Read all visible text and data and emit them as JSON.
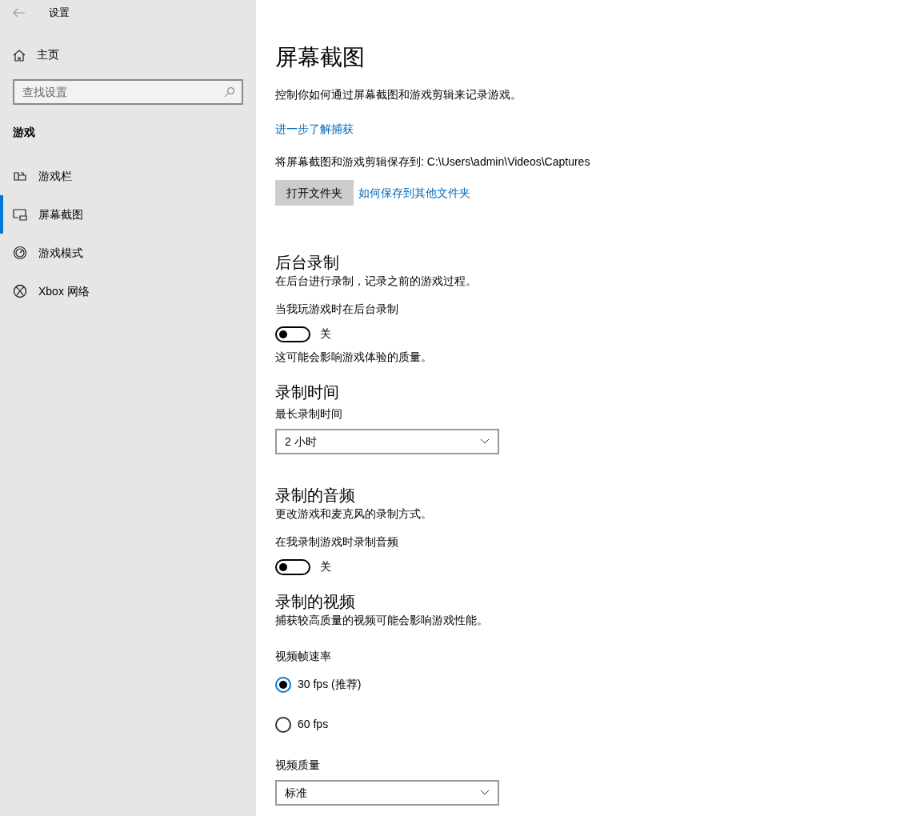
{
  "window": {
    "title": "设置"
  },
  "sidebar": {
    "home": "主页",
    "search": {
      "placeholder": "查找设置"
    },
    "group": "游戏",
    "items": [
      {
        "label": "游戏栏",
        "selected": false
      },
      {
        "label": "屏幕截图",
        "selected": true
      },
      {
        "label": "游戏模式",
        "selected": false
      },
      {
        "label": "Xbox 网络",
        "selected": false
      }
    ]
  },
  "page": {
    "title": "屏幕截图",
    "description": "控制你如何通过屏幕截图和游戏剪辑来记录游戏。",
    "learn_link": "进一步了解捕获",
    "save_path": "将屏幕截图和游戏剪辑保存到: C:\\Users\\admin\\Videos\\Captures",
    "open_button": "打开文件夹",
    "other_folder_link": "如何保存到其他文件夹"
  },
  "sections": [
    {
      "heading": "后台录制",
      "description": "在后台进行录制，记录之前的游戏过程。",
      "items": [
        {
          "kind": "toggle",
          "label": "当我玩游戏时在后台录制",
          "on": false,
          "state_text": "关",
          "note": "这可能会影响游戏体验的质量。"
        }
      ]
    },
    {
      "heading": "录制时间",
      "items": [
        {
          "kind": "dropdown",
          "label": "最长录制时间",
          "value": "2 小时"
        }
      ]
    },
    {
      "heading": "录制的音频",
      "description": "更改游戏和麦克风的录制方式。",
      "items": [
        {
          "kind": "toggle",
          "label": "在我录制游戏时录制音频",
          "on": false,
          "state_text": "关"
        }
      ]
    },
    {
      "heading": "录制的视频",
      "description": "捕获较高质量的视频可能会影响游戏性能。",
      "items": [
        {
          "kind": "radio",
          "label": "视频帧速率",
          "options": [
            {
              "label": "30 fps (推荐)",
              "selected": true
            },
            {
              "label": "60 fps",
              "selected": false
            }
          ]
        },
        {
          "kind": "dropdown",
          "label": "视频质量",
          "value": "标准"
        }
      ]
    }
  ]
}
